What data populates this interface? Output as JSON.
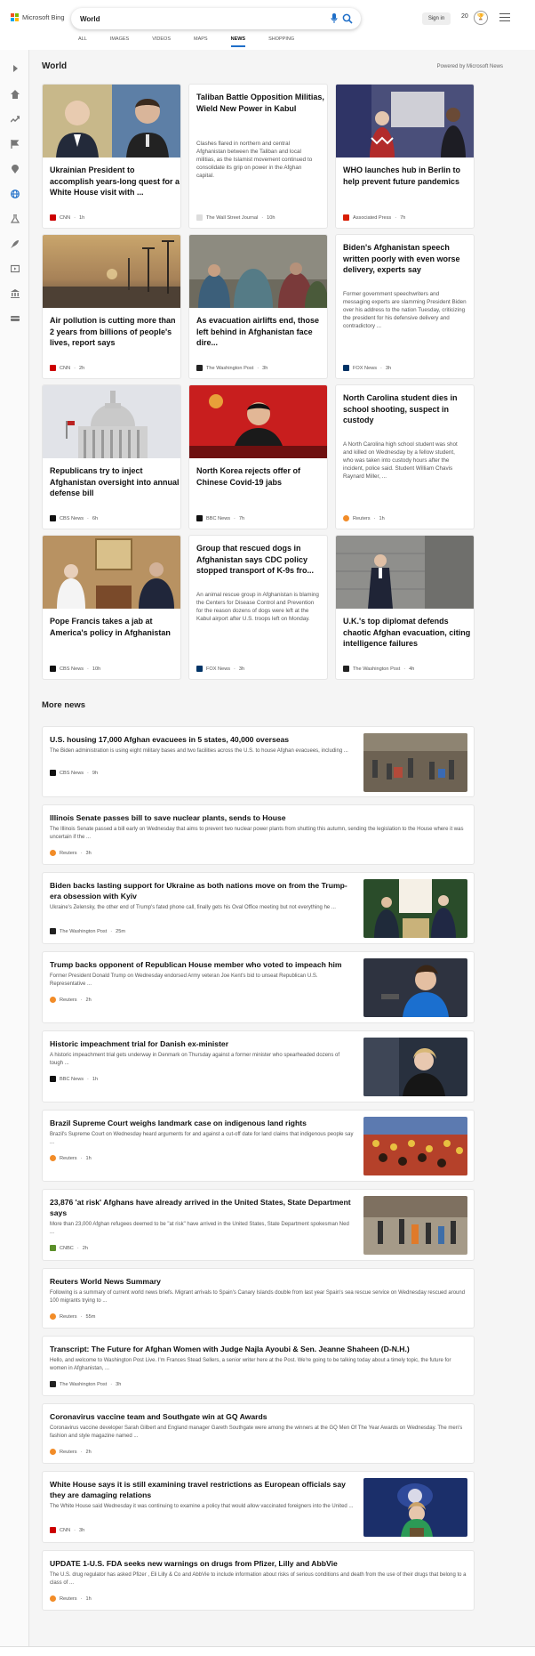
{
  "brand": {
    "name": "Microsoft Bing",
    "colors": [
      "#f25022",
      "#7fba00",
      "#00a4ef",
      "#ffb900"
    ]
  },
  "search": {
    "query": "World"
  },
  "header": {
    "sign_in": "Sign in",
    "rewards_count": "20"
  },
  "tabs": [
    {
      "label": "ALL"
    },
    {
      "label": "IMAGES"
    },
    {
      "label": "VIDEOS"
    },
    {
      "label": "MAPS"
    },
    {
      "label": "NEWS",
      "active": true
    },
    {
      "label": "SHOPPING"
    }
  ],
  "sidebar": {
    "icons": [
      "expand-icon",
      "home-icon",
      "trending-icon",
      "flag-icon",
      "location-icon",
      "globe-icon",
      "science-icon",
      "rocket-icon",
      "entertainment-icon",
      "business-icon",
      "money-icon"
    ],
    "accent": "#1e6ec8"
  },
  "section": {
    "title": "World",
    "powered": "Powered by Microsoft News"
  },
  "cards": [
    {
      "title": "Ukrainian President to accomplish years-long quest for a White House visit with ...",
      "desc": "",
      "source": "CNN",
      "time": "1h",
      "logo_color": "#cc0000",
      "has_image": true
    },
    {
      "title": "Taliban Battle Opposition Militias, Wield New Power in Kabul",
      "desc": "Clashes flared in northern and central Afghanistan between the Taliban and local militias, as the Islamist movement continued to consolidate its grip on power in the Afghan capital.",
      "source": "The Wall Street Journal",
      "time": "10h",
      "logo_color": "#555555",
      "has_image": false
    },
    {
      "title": "WHO launches hub in Berlin to help prevent future pandemics",
      "desc": "",
      "source": "Associated Press",
      "time": "7h",
      "logo_color": "#d81e05",
      "has_image": true
    },
    {
      "title": "Air pollution is cutting more than 2 years from billions of people's lives, report says",
      "desc": "",
      "source": "CNN",
      "time": "2h",
      "logo_color": "#cc0000",
      "has_image": true
    },
    {
      "title": "As evacuation airlifts end, those left behind in Afghanistan face dire...",
      "desc": "",
      "source": "The Washington Post",
      "time": "3h",
      "logo_color": "#222222",
      "has_image": true
    },
    {
      "title": "Biden's Afghanistan speech written poorly with even worse delivery, experts say",
      "desc": "Former government speechwriters and messaging experts are slamming President Biden over his address to the nation Tuesday, criticizing the president for his defensive delivery and contradictory ...",
      "source": "FOX News",
      "time": "3h",
      "logo_color": "#003366",
      "has_image": false
    },
    {
      "title": "Republicans try to inject Afghanistan oversight into annual defense bill",
      "desc": "",
      "source": "CBS News",
      "time": "6h",
      "logo_color": "#111111",
      "has_image": true
    },
    {
      "title": "North Korea rejects offer of Chinese Covid-19 jabs",
      "desc": "",
      "source": "BBC News",
      "time": "7h",
      "logo_color": "#111111",
      "has_image": true
    },
    {
      "title": "North Carolina student dies in school shooting, suspect in custody",
      "desc": "A North Carolina high school student was shot and killed on Wednesday by a fellow student, who was taken into custody hours after the incident, police said. Student William Chavis Raynard Miller, ...",
      "source": "Reuters",
      "time": "1h",
      "logo_color": "#f28c28",
      "has_image": false
    },
    {
      "title": "Pope Francis takes a jab at America's policy in Afghanistan",
      "desc": "",
      "source": "CBS News",
      "time": "10h",
      "logo_color": "#111111",
      "has_image": true
    },
    {
      "title": "Group that rescued dogs in Afghanistan says CDC policy stopped transport of K-9s fro...",
      "desc": "An animal rescue group in Afghanistan is blaming the Centers for Disease Control and Prevention for the reason dozens of dogs were left at the Kabul airport after U.S. troops left on Monday.",
      "source": "FOX News",
      "time": "3h",
      "logo_color": "#003366",
      "has_image": false
    },
    {
      "title": "U.K.'s top diplomat defends chaotic Afghan evacuation, citing intelligence failures",
      "desc": "",
      "source": "The Washington Post",
      "time": "4h",
      "logo_color": "#222222",
      "has_image": true
    }
  ],
  "more_news": {
    "title": "More news",
    "items": [
      {
        "title": "U.S. housing 17,000 Afghan evacuees in 5 states, 40,000 overseas",
        "desc": "The Biden administration is using eight military bases and two facilities across the U.S. to house Afghan evacuees, including ...",
        "source": "CBS News",
        "time": "9h",
        "logo_color": "#111111",
        "thumb": true
      },
      {
        "title": "Illinois Senate passes bill to save nuclear plants, sends to House",
        "desc": "The Illinois Senate passed a bill early on Wednesday that aims to prevent two nuclear power plants from shutting this autumn, sending the legislation to the House where it was uncertain if the ...",
        "source": "Reuters",
        "time": "3h",
        "logo_color": "#f28c28",
        "thumb": false
      },
      {
        "title": "Biden backs lasting support for Ukraine as both nations move on from the Trump-era obsession with Kyiv",
        "desc": "Ukraine's Zelensky, the other end of Trump's fated phone call, finally gets his Oval Office meeting but not everything he ...",
        "source": "The Washington Post",
        "time": "25m",
        "logo_color": "#222222",
        "thumb": true
      },
      {
        "title": "Trump backs opponent of Republican House member who voted to impeach him",
        "desc": "Former President Donald Trump on Wednesday endorsed Army veteran Joe Kent's bid to unseat Republican U.S. Representative ...",
        "source": "Reuters",
        "time": "2h",
        "logo_color": "#f28c28",
        "thumb": true
      },
      {
        "title": "Historic impeachment trial for Danish ex-minister",
        "desc": "A historic impeachment trial gets underway in Denmark on Thursday against a former minister who spearheaded dozens of tough ...",
        "source": "BBC News",
        "time": "1h",
        "logo_color": "#111111",
        "thumb": true
      },
      {
        "title": "Brazil Supreme Court weighs landmark case on indigenous land rights",
        "desc": "Brazil's Supreme Court on Wednesday heard arguments for and against a cut-off date for land claims that indigenous people say ...",
        "source": "Reuters",
        "time": "1h",
        "logo_color": "#f28c28",
        "thumb": true
      },
      {
        "title": "23,876 'at risk' Afghans have already arrived in the United States, State Department says",
        "desc": "More than 23,000 Afghan refugees deemed to be \"at risk\" have arrived in the United States, State Department spokesman Ned ...",
        "source": "CNBC",
        "time": "2h",
        "logo_color": "#5b8f2a",
        "thumb": true
      },
      {
        "title": "Reuters World News Summary",
        "desc": "Following is a summary of current world news briefs. Migrant arrivals to Spain's Canary Islands double from last year Spain's sea rescue service on Wednesday rescued around 100 migrants trying to ...",
        "source": "Reuters",
        "time": "55m",
        "logo_color": "#f28c28",
        "thumb": false
      },
      {
        "title": "Transcript: The Future for Afghan Women with Judge Najla Ayoubi & Sen. Jeanne Shaheen (D-N.H.)",
        "desc": "Hello, and welcome to Washington Post Live. I'm Frances Stead Sellers, a senior writer here at the Post. We're going to be talking today about a timely topic, the future for women in Afghanistan, ...",
        "source": "The Washington Post",
        "time": "3h",
        "logo_color": "#222222",
        "thumb": false
      },
      {
        "title": "Coronavirus vaccine team and Southgate win at GQ Awards",
        "desc": "Coronavirus vaccine developer Sarah Gilbert and England manager Gareth Southgate were among the winners at the GQ Men Of The Year Awards on Wednesday. The men's fashion and style magazine named ...",
        "source": "Reuters",
        "time": "2h",
        "logo_color": "#f28c28",
        "thumb": false
      },
      {
        "title": "White House says it is still examining travel restrictions as European officials say they are damaging relations",
        "desc": "The White House said Wednesday it was continuing to examine a policy that would allow vaccinated foreigners into the United ...",
        "source": "CNN",
        "time": "3h",
        "logo_color": "#cc0000",
        "thumb": true
      },
      {
        "title": "UPDATE 1-U.S. FDA seeks new warnings on drugs from Pfizer, Lilly and AbbVie",
        "desc": "The U.S. drug regulator has asked Pfizer , Eli Lilly & Co and AbbVie to include information about risks of serious conditions and death from the use of their drugs that belong to a class of ...",
        "source": "Reuters",
        "time": "1h",
        "logo_color": "#f28c28",
        "thumb": false
      }
    ]
  }
}
